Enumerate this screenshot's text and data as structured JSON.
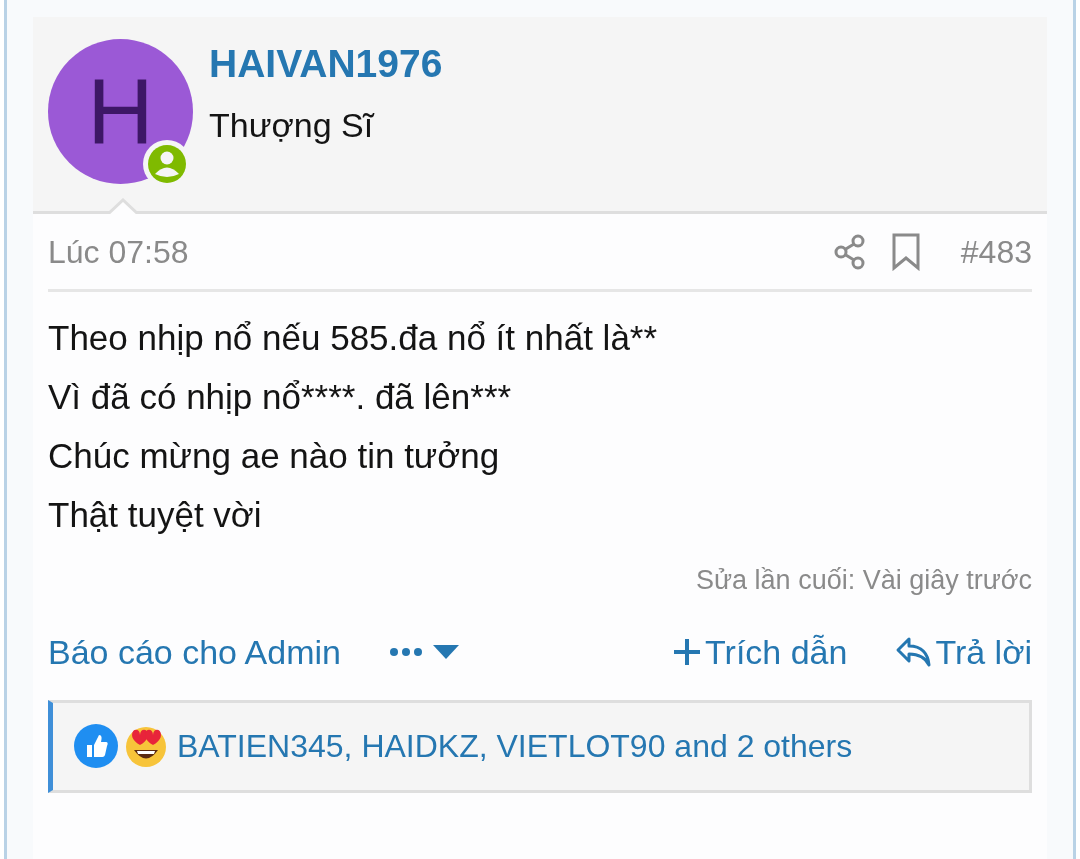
{
  "author": {
    "name": "HAIVAN1976",
    "rank": "Thượng Sĩ",
    "avatar_letter": "H",
    "online": true
  },
  "post": {
    "time": "Lúc 07:58",
    "number": "#483",
    "lines": [
      "Theo nhịp nổ nếu 585.đa nổ ít nhất là**",
      "Vì đã có nhịp nổ****. đã lên***",
      "Chúc mừng ae nào tin tưởng",
      "Thật tuyệt vời"
    ],
    "edited": "Sửa lần cuối: Vài giây trước"
  },
  "actions": {
    "report": "Báo cáo cho Admin",
    "quote": "Trích dẫn",
    "reply": "Trả lời"
  },
  "reactions": {
    "text": "BATIEN345, HAIDKZ, VIETLOT90 and 2 others"
  }
}
